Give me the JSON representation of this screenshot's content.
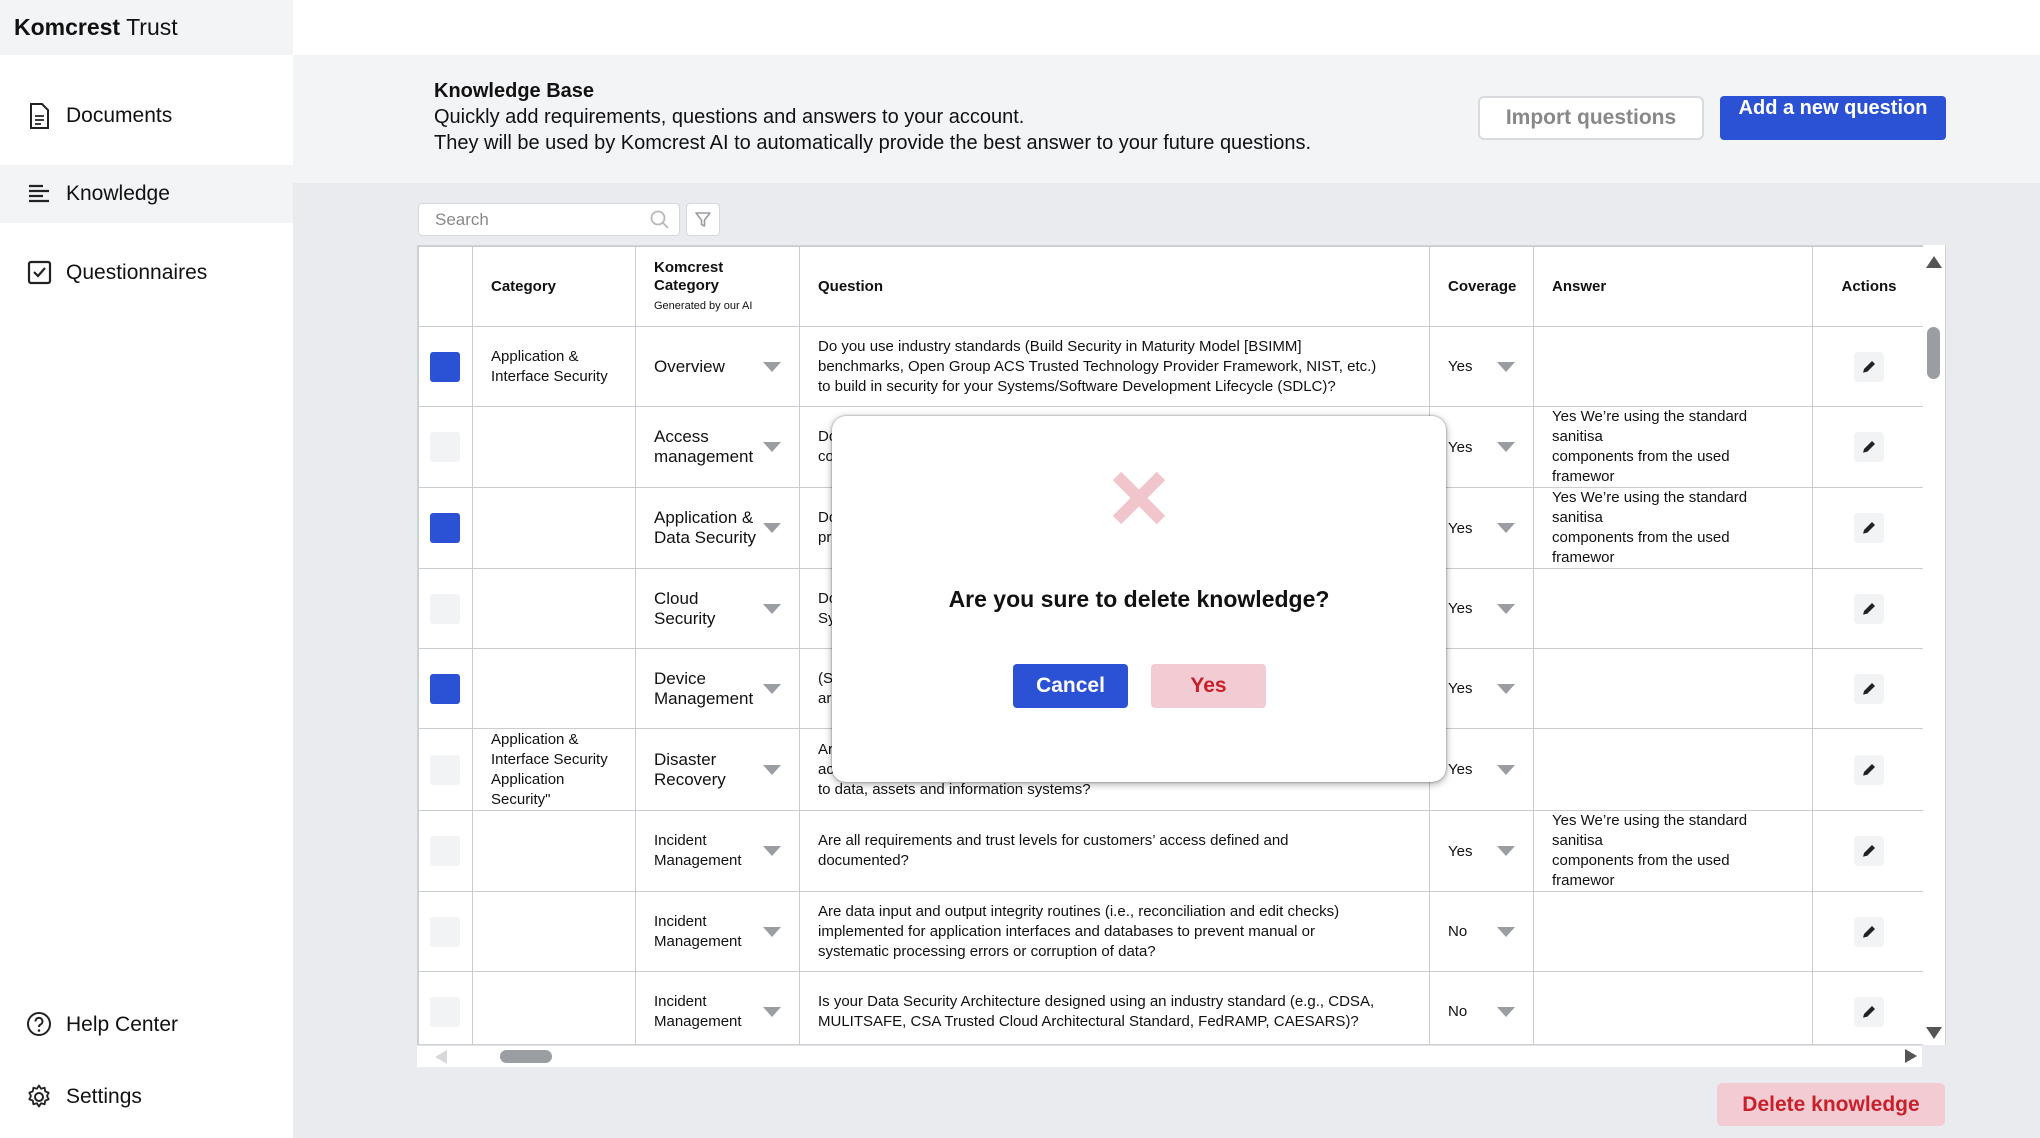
{
  "brand": {
    "bold": "Komcrest",
    "rest": " Trust"
  },
  "nav": {
    "documents": "Documents",
    "knowledge": "Knowledge",
    "questionnaires": "Questionnaires",
    "help": "Help Center",
    "settings": "Settings"
  },
  "header": {
    "title": "Knowledge Base",
    "line1": "Quickly add requirements, questions and answers to your account.",
    "line2": "They will be used by Komcrest AI to automatically provide the best answer to your future questions.",
    "import_label": "Import questions",
    "add_label": "Add a new question"
  },
  "search": {
    "placeholder": "Search"
  },
  "table": {
    "headers": {
      "category": "Category",
      "komcrest_category": "Komcrest Category",
      "komcrest_sub": "Generated by our AI",
      "question": "Question",
      "coverage": "Coverage",
      "answer": "Answer",
      "actions": "Actions"
    },
    "rows": [
      {
        "checked": true,
        "category": "Application & Interface Security",
        "kc": "Overview",
        "question": "Do you use industry standards (Build Security in Maturity Model [BSIMM]\nbenchmarks, Open Group ACS Trusted Technology Provider Framework, NIST, etc.)\nto build in security for your Systems/Software Development Lifecycle (SDLC)?",
        "coverage": "Yes",
        "answer": ""
      },
      {
        "checked": false,
        "category": "",
        "kc": "Access management",
        "question": "Do\nco",
        "coverage": "Yes",
        "answer": "Yes  We’re using the standard sanitisa\ncomponents from the used framewor"
      },
      {
        "checked": true,
        "category": "",
        "kc": "Application & Data Security",
        "question": "Do\npr",
        "coverage": "Yes",
        "answer": "Yes  We’re using the standard sanitisa\ncomponents from the used framewor"
      },
      {
        "checked": false,
        "category": "",
        "kc": "Cloud Security",
        "question": "Do\nSy",
        "coverage": "Yes",
        "answer": ""
      },
      {
        "checked": true,
        "category": "",
        "kc": "Device Management",
        "question": "(S\nar",
        "coverage": "Yes",
        "answer": ""
      },
      {
        "checked": false,
        "category": "Application & Interface Security Application Security\"",
        "kc": "Disaster Recovery",
        "question": "Ar\nac\nto data, assets and information systems?",
        "coverage": "Yes",
        "answer": ""
      },
      {
        "checked": false,
        "category": "",
        "kc": "Incident Management",
        "question": "Are all requirements and trust levels for customers’ access defined and\ndocumented?",
        "coverage": "Yes",
        "answer": "Yes  We’re using the standard sanitisa\ncomponents from the used framewor"
      },
      {
        "checked": false,
        "category": "",
        "kc": "Incident Management",
        "question": "Are data input and output integrity routines (i.e., reconciliation and edit checks)\nimplemented for application interfaces and databases to prevent manual or\nsystematic processing errors or corruption of data?",
        "coverage": "No",
        "answer": ""
      },
      {
        "checked": false,
        "category": "",
        "kc": "Incident Management",
        "question": "Is your Data Security Architecture designed using an industry standard (e.g., CDSA,\nMULITSAFE, CSA Trusted Cloud Architectural Standard, FedRAMP, CAESARS)?",
        "coverage": "No",
        "answer": ""
      }
    ]
  },
  "delete_label": "Delete knowledge",
  "modal": {
    "message": "Are you sure to delete knowledge?",
    "cancel": "Cancel",
    "yes": "Yes"
  },
  "colors": {
    "primary": "#2b52d4",
    "danger_bg": "#f3ccd3",
    "danger_text": "#c8202b",
    "x_icon": "#f1c5cc"
  }
}
